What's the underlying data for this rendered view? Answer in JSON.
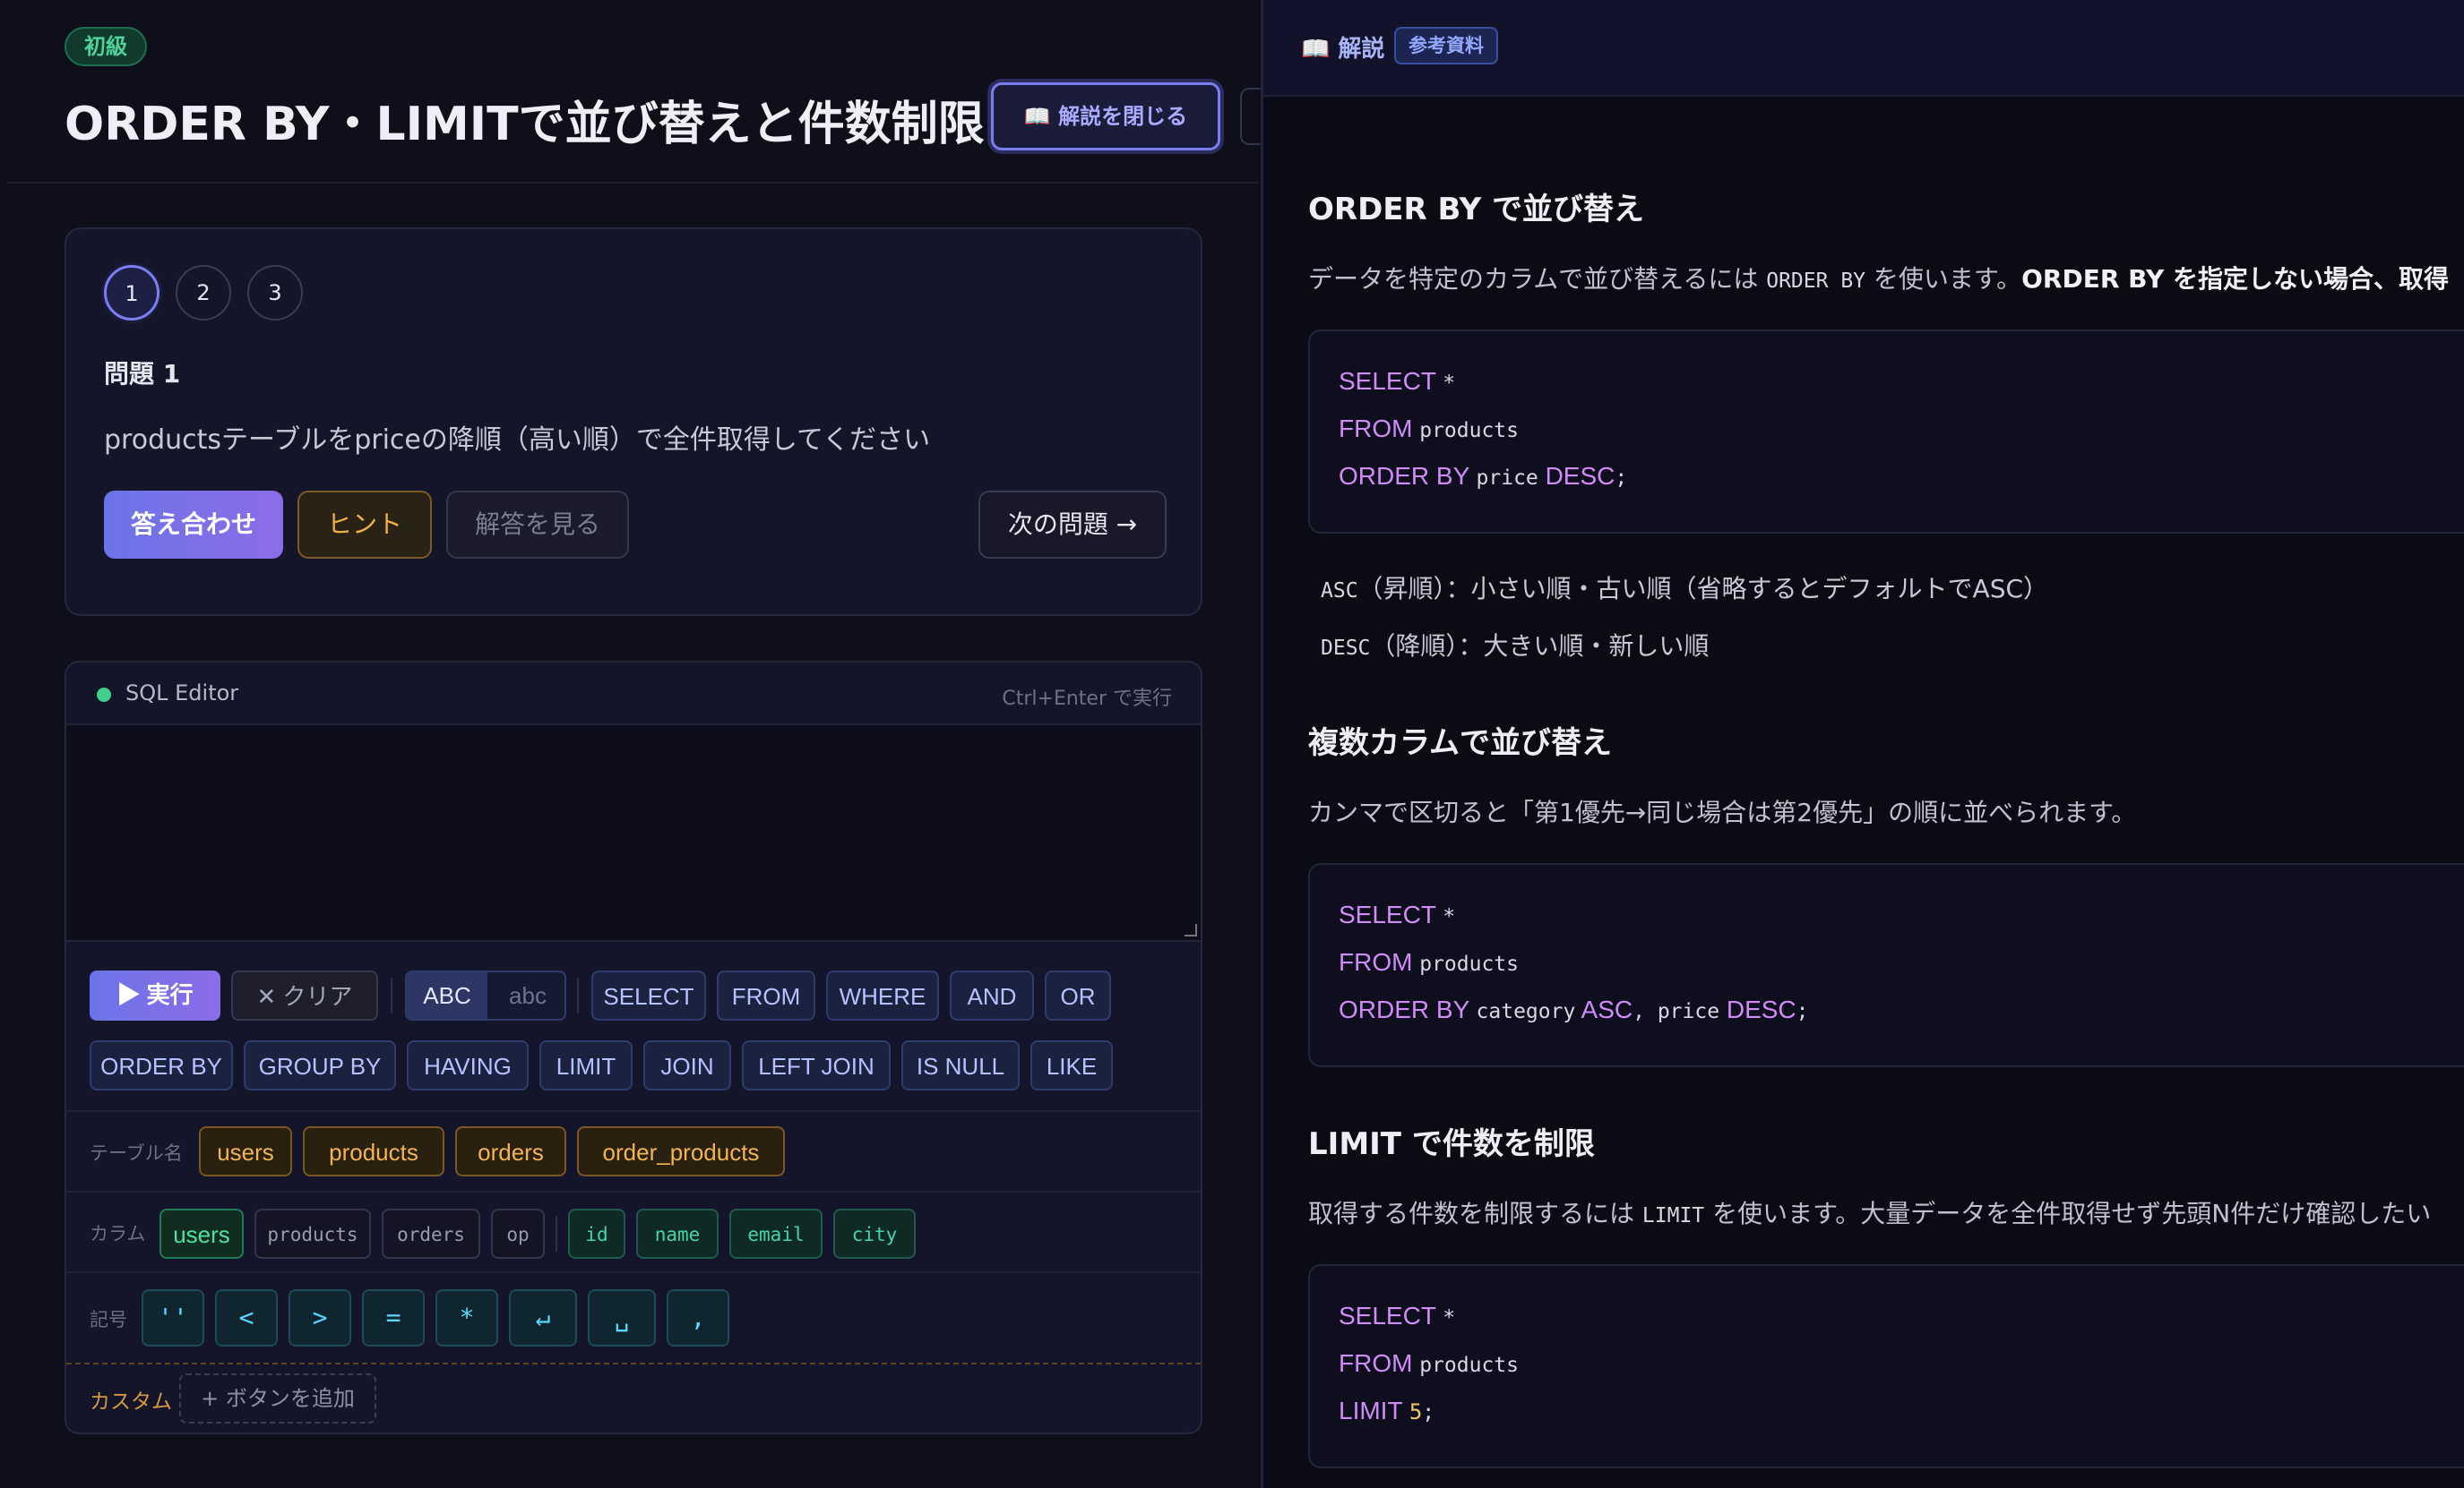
{
  "header": {
    "level": "初級",
    "title": "ORDER BY・LIMITで並び替えと件数制限",
    "toggle_label": "📖 解説を閉じる"
  },
  "question": {
    "steps": [
      "1",
      "2",
      "3"
    ],
    "active_step": 1,
    "title": "問題 1",
    "text": "productsテーブルをpriceの降順（高い順）で全件取得してください",
    "buttons": {
      "check": "答え合わせ",
      "hint": "ヒント",
      "answer": "解答を見る",
      "next": "次の問題 →"
    }
  },
  "editor": {
    "title": "SQL Editor",
    "shortcut": "Ctrl+Enter で実行",
    "run": "▶ 実行",
    "clear": "✕ クリア",
    "case_upper": "ABC",
    "case_lower": "abc",
    "keywords_row1": [
      "SELECT",
      "FROM",
      "WHERE",
      "AND",
      "OR"
    ],
    "keywords_row2": [
      "ORDER BY",
      "GROUP BY",
      "HAVING",
      "LIMIT",
      "JOIN",
      "LEFT JOIN",
      "IS NULL",
      "LIKE"
    ],
    "tables_label": "テーブル名",
    "tables": [
      "users",
      "products",
      "orders",
      "order_products"
    ],
    "columns_label": "カラム",
    "column_tables": [
      "users",
      "products",
      "orders",
      "op"
    ],
    "columns": [
      "id",
      "name",
      "email",
      "city"
    ],
    "symbols_label": "記号",
    "symbols": [
      "''",
      "<",
      ">",
      "=",
      "*",
      "↵",
      "␣",
      ","
    ],
    "custom_label": "カスタム",
    "add_button": "+ ボタンを追加"
  },
  "explanation": {
    "title": "📖 解説",
    "badge": "参考資料",
    "s1_heading": "ORDER BY で並び替え",
    "s1_text_a": "データを特定のカラムで並び替えるには",
    "s1_code": "ORDER BY",
    "s1_text_b": "を使います。",
    "s1_bold": "ORDER BY を指定しない場合、取得",
    "code1": {
      "l1k": "SELECT",
      "l1": "*",
      "l2k": "FROM",
      "l2": "products",
      "l3k": "ORDER BY",
      "l3": "price",
      "l3k2": "DESC",
      "l3end": ";"
    },
    "asc_code": "ASC",
    "asc_text": "（昇順）：小さい順・古い順（省略するとデフォルトでASC）",
    "desc_code": "DESC",
    "desc_text": "（降順）：大きい順・新しい順",
    "s2_heading": "複数カラムで並び替え",
    "s2_text": "カンマで区切ると「第1優先→同じ場合は第2優先」の順に並べられます。",
    "code2": {
      "l1k": "SELECT",
      "l1": "*",
      "l2k": "FROM",
      "l2": "products",
      "l3k": "ORDER BY",
      "l3a": "category",
      "l3k2": "ASC",
      "l3b": ", price",
      "l3k3": "DESC",
      "l3end": ";"
    },
    "s3_heading": "LIMIT で件数を制限",
    "s3_text_a": "取得する件数を制限するには",
    "s3_code": "LIMIT",
    "s3_text_b": "を使います。大量データを全件取得せず先頭N件だけ確認したい",
    "code3": {
      "l1k": "SELECT",
      "l1": "*",
      "l2k": "FROM",
      "l2": "products",
      "l3k": "LIMIT",
      "l3n": "5",
      "l3end": ";"
    }
  }
}
